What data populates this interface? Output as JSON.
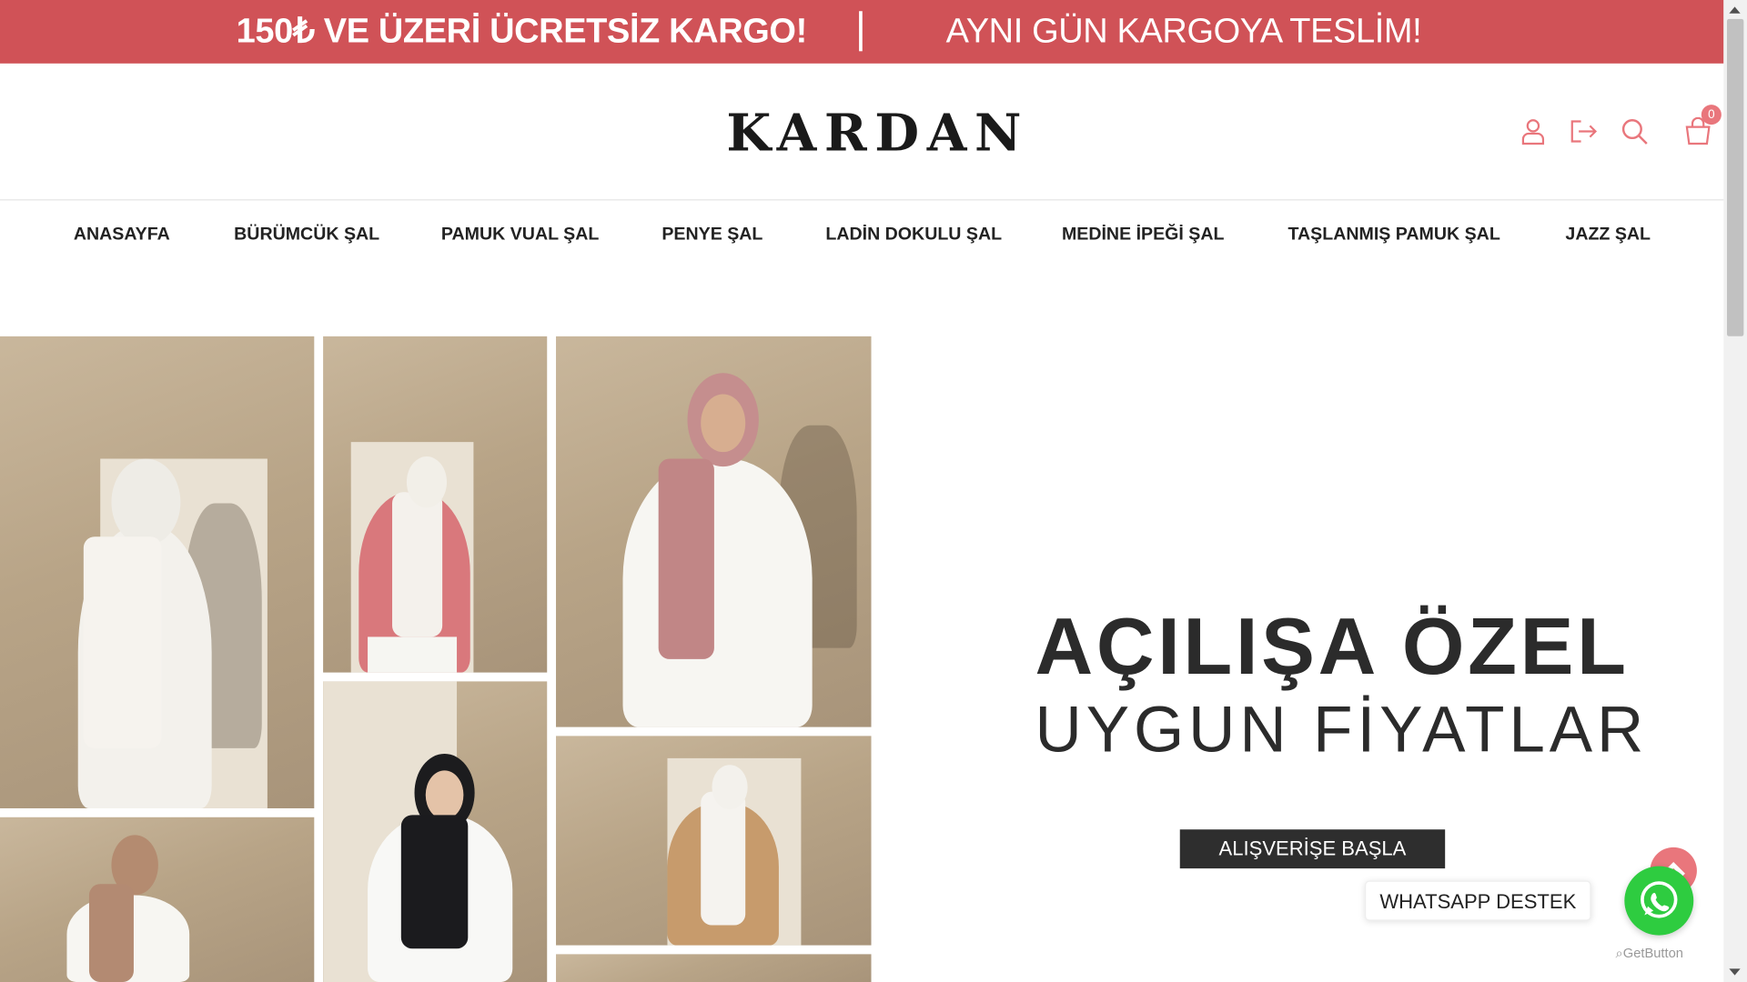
{
  "topbar": {
    "promo_left": "150₺ VE ÜZERİ ÜCRETSİZ KARGO!",
    "promo_right": "AYNI GÜN KARGOYA TESLİM!",
    "background": "#d05257"
  },
  "header": {
    "logo": "KARDAN",
    "icons": [
      "user-icon",
      "logout-icon",
      "search-icon",
      "cart-icon"
    ],
    "cart_count": "0",
    "icon_color": "#e9767c"
  },
  "nav": {
    "items": [
      {
        "label": "ANASAYFA"
      },
      {
        "label": "BÜRÜMCÜK ŞAL"
      },
      {
        "label": "PAMUK VUAL ŞAL"
      },
      {
        "label": "PENYE ŞAL"
      },
      {
        "label": "LADİN DOKULU ŞAL"
      },
      {
        "label": "MEDİNE İPEĞİ ŞAL"
      },
      {
        "label": "TAŞLANMIŞ PAMUK ŞAL"
      },
      {
        "label": "JAZZ ŞAL"
      }
    ]
  },
  "hero": {
    "title": "AÇILIŞA ÖZEL",
    "subtitle": "UYGUN FİYATLAR",
    "cta_label": "ALIŞVERİŞE BAŞLA"
  },
  "widgets": {
    "whatsapp_label": "WHATSAPP DESTEK",
    "getbutton_label": "GetButton",
    "whatsapp_color": "#2ecc40"
  }
}
